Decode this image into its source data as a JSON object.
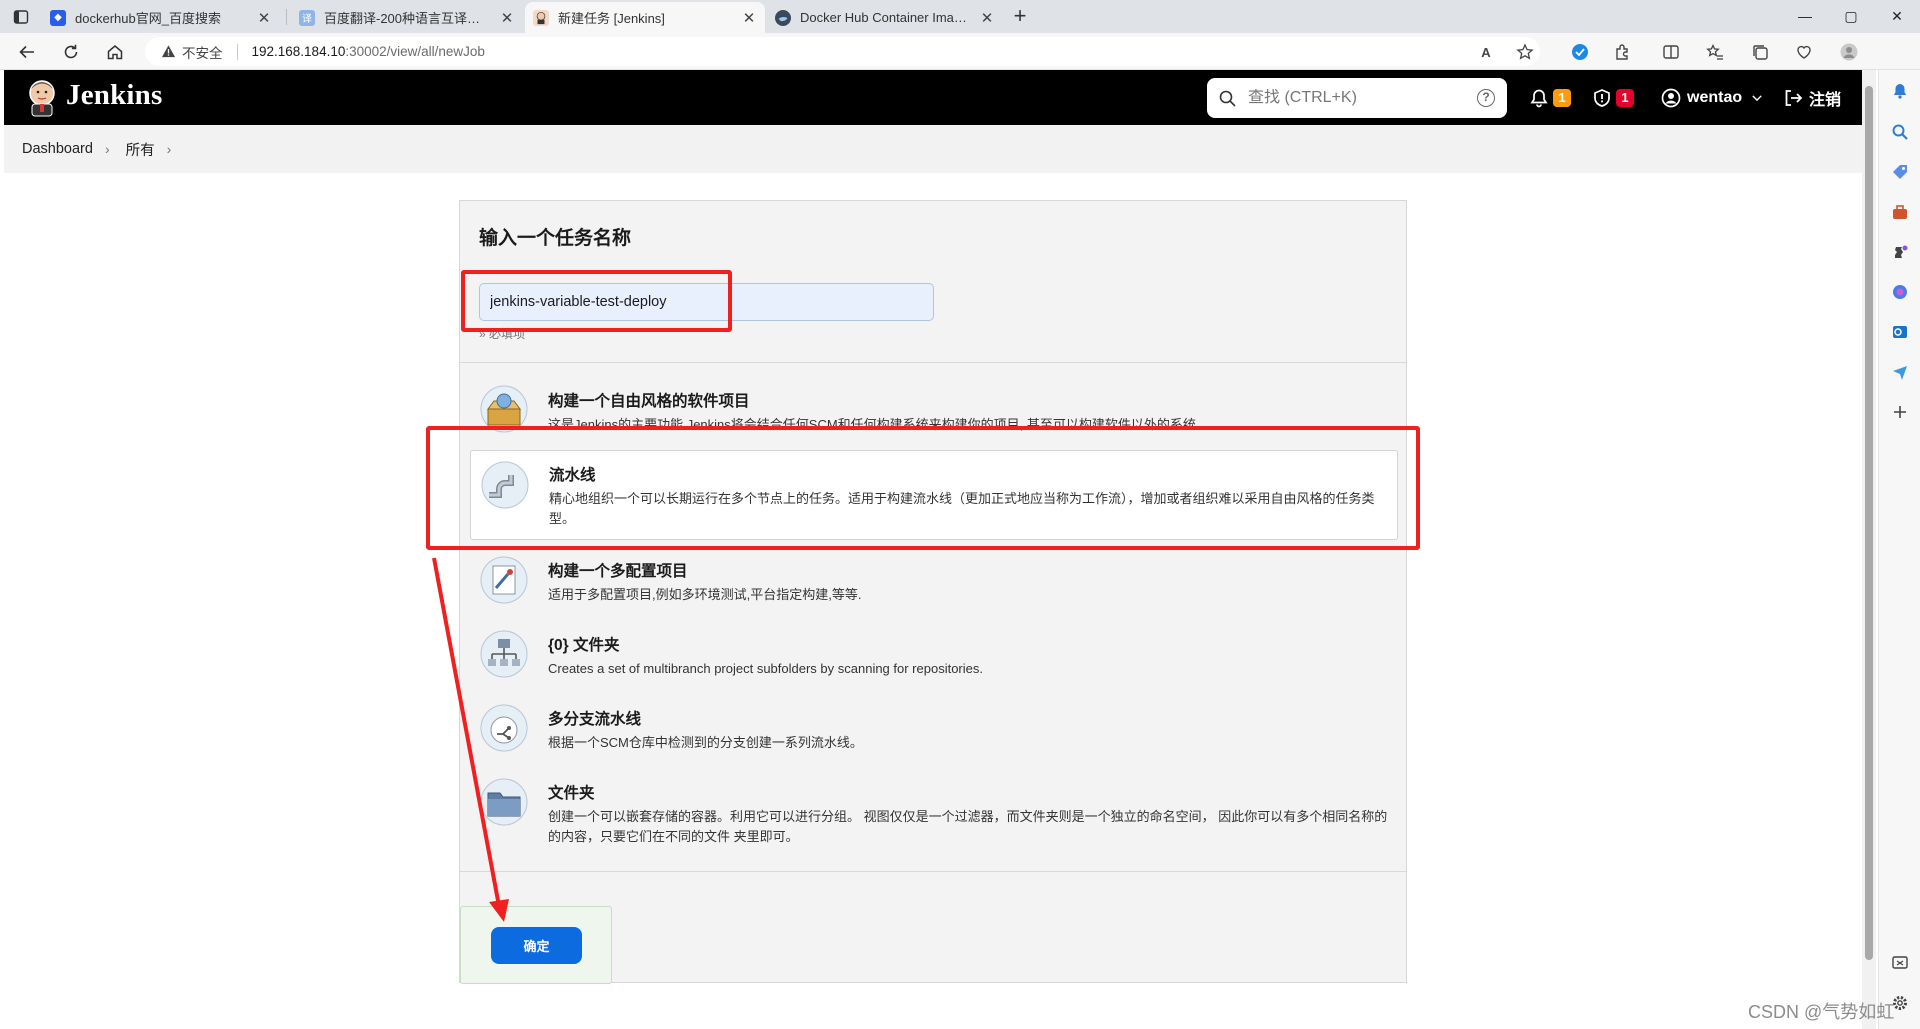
{
  "browser": {
    "tabs": [
      {
        "title": "dockerhub官网_百度搜索",
        "close": "✕"
      },
      {
        "title": "百度翻译-200种语言互译、沟通全世界！",
        "close": "✕"
      },
      {
        "title": "新建任务 [Jenkins]",
        "close": "✕"
      },
      {
        "title": "Docker Hub Container Image Library",
        "close": "✕"
      }
    ],
    "newtab": "+",
    "window_controls": [
      "—",
      "▢",
      "✕"
    ],
    "address": {
      "security": "不安全",
      "host": "192.168.184.10",
      "path": ":30002/view/all/newJob"
    },
    "read_aloud": "A",
    "colors": {
      "tabbar": "#dfe3e8",
      "active_tab": "#f7f7f7"
    }
  },
  "jenkins": {
    "brand": "Jenkins",
    "search": {
      "placeholder": "查找 (CTRL+K)",
      "help": "?"
    },
    "notifications": {
      "count": "1"
    },
    "security": {
      "count": "1"
    },
    "user": "wentao",
    "logout": "注销",
    "breadcrumb": [
      "Dashboard",
      "所有"
    ],
    "colors": {
      "header": "#000000",
      "primary": "#0b6bdf",
      "badge_orange": "#fe9b0f",
      "badge_red": "#e6002b"
    }
  },
  "form": {
    "title": "输入一个任务名称",
    "name_value": "jenkins-variable-test-deploy",
    "required_hint": "» 必填项",
    "items": [
      {
        "name": "构建一个自由风格的软件项目",
        "desc": "这是Jenkins的主要功能.Jenkins将会结合任何SCM和任何构建系统来构建你的项目, 甚至可以构建软件以外的系统.",
        "icon": "freestyle-icon"
      },
      {
        "name": "流水线",
        "desc": "精心地组织一个可以长期运行在多个节点上的任务。适用于构建流水线（更加正式地应当称为工作流），增加或者组织难以采用自由风格的任务类型。",
        "icon": "pipeline-icon",
        "selected": true
      },
      {
        "name": "构建一个多配置项目",
        "desc": "适用于多配置项目,例如多环境测试,平台指定构建,等等.",
        "icon": "multiconfig-icon"
      },
      {
        "name": "{0} 文件夹",
        "desc": "Creates a set of multibranch project subfolders by scanning for repositories.",
        "icon": "org-folder-icon"
      },
      {
        "name": "多分支流水线",
        "desc": "根据一个SCM仓库中检测到的分支创建一系列流水线。",
        "icon": "multibranch-icon"
      },
      {
        "name": "文件夹",
        "desc": "创建一个可以嵌套存储的容器。利用它可以进行分组。 视图仅仅是一个过滤器，而文件夹则是一个独立的命名空间， 因此你可以有多个相同名称的的内容，只要它们在不同的文件 夹里即可。",
        "icon": "folder-icon"
      }
    ],
    "ok_label": "确定"
  },
  "watermark": "CSDN @气势如虹"
}
